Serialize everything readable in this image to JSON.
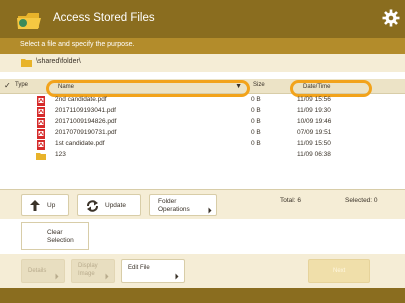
{
  "header": {
    "title": "Access Stored Files"
  },
  "instruction": "Select a file and specify the purpose.",
  "path": "\\shared\\folder\\",
  "columns": {
    "type": "Type",
    "name": "Name",
    "size": "Size",
    "datetime": "Date/Time"
  },
  "files": [
    {
      "name": "2nd candidate.pdf",
      "size": "0 B",
      "date": "11/09 15:56",
      "kind": "pdf"
    },
    {
      "name": "20171109193041.pdf",
      "size": "0 B",
      "date": "11/09 19:30",
      "kind": "pdf"
    },
    {
      "name": "20171009194826.pdf",
      "size": "0 B",
      "date": "10/09 19:46",
      "kind": "pdf"
    },
    {
      "name": "20170709190731.pdf",
      "size": "0 B",
      "date": "07/09 19:51",
      "kind": "pdf"
    },
    {
      "name": "1st candidate.pdf",
      "size": "0 B",
      "date": "11/09 15:50",
      "kind": "pdf"
    },
    {
      "name": "123",
      "size": "",
      "date": "11/09 06:38",
      "kind": "folder"
    }
  ],
  "toolbar": {
    "up": "Up",
    "update": "Update",
    "folder_ops_line1": "Folder",
    "folder_ops_line2": "Operations",
    "total": "Total: 6",
    "selected": "Selected: 0"
  },
  "clear": {
    "line1": "Clear",
    "line2": "Selection"
  },
  "bottom": {
    "details": "Details",
    "display_line1": "Display",
    "display_line2": "Image",
    "edit_file": "Edit File",
    "next": "Next"
  },
  "colors": {
    "header": "#8a6d1f",
    "accent": "#f2a31b",
    "pdf": "#d62b2b",
    "folder": "#e8b32a"
  }
}
